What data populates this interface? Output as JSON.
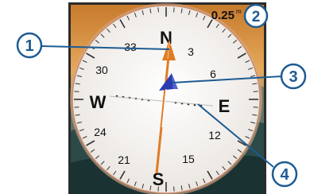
{
  "screen": {
    "distance_readout": "0.25",
    "distance_unit_glyph": "m"
  },
  "compass": {
    "cardinal": {
      "north": "N",
      "east": "E",
      "south": "S",
      "west": "W"
    },
    "degree_labels": [
      "3",
      "6",
      "12",
      "15",
      "21",
      "24",
      "30",
      "33"
    ]
  },
  "callouts": [
    "1",
    "2",
    "3",
    "4"
  ],
  "colors": {
    "bezel": "#2b2b2b",
    "dial_face": "#f4f1ee",
    "ring_rim": "#c98e6b",
    "course_pointer": "#e07b24",
    "bearing_pointer": "#2d3bb0",
    "callout_fill": "#ffffff",
    "callout_text": "#1e5b93",
    "callout_line": "#1e5b93",
    "sky_top": "#d88e3a",
    "sky_mid": "#e9b266",
    "hills": "#1f3b3c"
  },
  "icons": [
    "course-pointer-icon",
    "bearing-pointer-icon",
    "course-deviation-dots-icon"
  ]
}
